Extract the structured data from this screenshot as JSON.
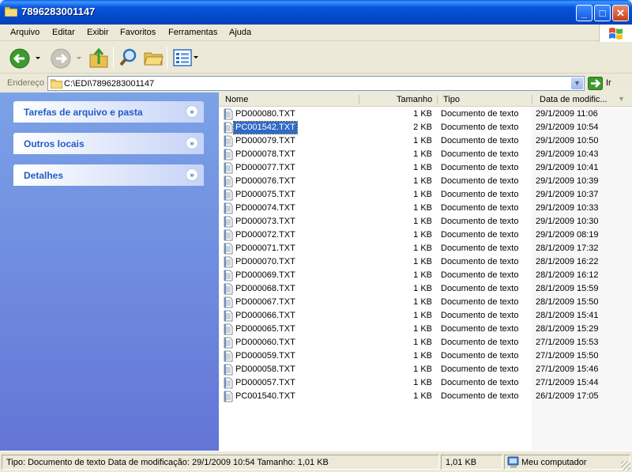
{
  "window": {
    "title": "7896283001147"
  },
  "menu": [
    "Arquivo",
    "Editar",
    "Exibir",
    "Favoritos",
    "Ferramentas",
    "Ajuda"
  ],
  "toolbar_icons": [
    "back-icon",
    "forward-icon",
    "up-folder-icon",
    "search-icon",
    "folders-icon",
    "views-icon"
  ],
  "address": {
    "label": "Endereço",
    "value": "C:\\EDI\\7896283001147",
    "go_label": "Ir"
  },
  "tasks": [
    "Tarefas de arquivo e pasta",
    "Outros locais",
    "Detalhes"
  ],
  "columns": {
    "name": "Nome",
    "size": "Tamanho",
    "type": "Tipo",
    "date": "Data de modific..."
  },
  "files": [
    {
      "name": "PD000080.TXT",
      "size": "1 KB",
      "type": "Documento de texto",
      "date": "29/1/2009 11:06"
    },
    {
      "name": "PC001542.TXT",
      "size": "2 KB",
      "type": "Documento de texto",
      "date": "29/1/2009 10:54",
      "selected": true
    },
    {
      "name": "PD000079.TXT",
      "size": "1 KB",
      "type": "Documento de texto",
      "date": "29/1/2009 10:50"
    },
    {
      "name": "PD000078.TXT",
      "size": "1 KB",
      "type": "Documento de texto",
      "date": "29/1/2009 10:43"
    },
    {
      "name": "PD000077.TXT",
      "size": "1 KB",
      "type": "Documento de texto",
      "date": "29/1/2009 10:41"
    },
    {
      "name": "PD000076.TXT",
      "size": "1 KB",
      "type": "Documento de texto",
      "date": "29/1/2009 10:39"
    },
    {
      "name": "PD000075.TXT",
      "size": "1 KB",
      "type": "Documento de texto",
      "date": "29/1/2009 10:37"
    },
    {
      "name": "PD000074.TXT",
      "size": "1 KB",
      "type": "Documento de texto",
      "date": "29/1/2009 10:33"
    },
    {
      "name": "PD000073.TXT",
      "size": "1 KB",
      "type": "Documento de texto",
      "date": "29/1/2009 10:30"
    },
    {
      "name": "PD000072.TXT",
      "size": "1 KB",
      "type": "Documento de texto",
      "date": "29/1/2009 08:19"
    },
    {
      "name": "PD000071.TXT",
      "size": "1 KB",
      "type": "Documento de texto",
      "date": "28/1/2009 17:32"
    },
    {
      "name": "PD000070.TXT",
      "size": "1 KB",
      "type": "Documento de texto",
      "date": "28/1/2009 16:22"
    },
    {
      "name": "PD000069.TXT",
      "size": "1 KB",
      "type": "Documento de texto",
      "date": "28/1/2009 16:12"
    },
    {
      "name": "PD000068.TXT",
      "size": "1 KB",
      "type": "Documento de texto",
      "date": "28/1/2009 15:59"
    },
    {
      "name": "PD000067.TXT",
      "size": "1 KB",
      "type": "Documento de texto",
      "date": "28/1/2009 15:50"
    },
    {
      "name": "PD000066.TXT",
      "size": "1 KB",
      "type": "Documento de texto",
      "date": "28/1/2009 15:41"
    },
    {
      "name": "PD000065.TXT",
      "size": "1 KB",
      "type": "Documento de texto",
      "date": "28/1/2009 15:29"
    },
    {
      "name": "PD000060.TXT",
      "size": "1 KB",
      "type": "Documento de texto",
      "date": "27/1/2009 15:53"
    },
    {
      "name": "PD000059.TXT",
      "size": "1 KB",
      "type": "Documento de texto",
      "date": "27/1/2009 15:50"
    },
    {
      "name": "PD000058.TXT",
      "size": "1 KB",
      "type": "Documento de texto",
      "date": "27/1/2009 15:46"
    },
    {
      "name": "PD000057.TXT",
      "size": "1 KB",
      "type": "Documento de texto",
      "date": "27/1/2009 15:44"
    },
    {
      "name": "PC001540.TXT",
      "size": "1 KB",
      "type": "Documento de texto",
      "date": "26/1/2009 17:05"
    }
  ],
  "status": {
    "info": "Tipo: Documento de texto Data de modificação: 29/1/2009 10:54 Tamanho: 1,01 KB",
    "size": "1,01 KB",
    "zone": "Meu computador"
  },
  "colors": {
    "title_blue": "#0348c8",
    "task_text": "#215dc6",
    "selection": "#316ac5"
  }
}
